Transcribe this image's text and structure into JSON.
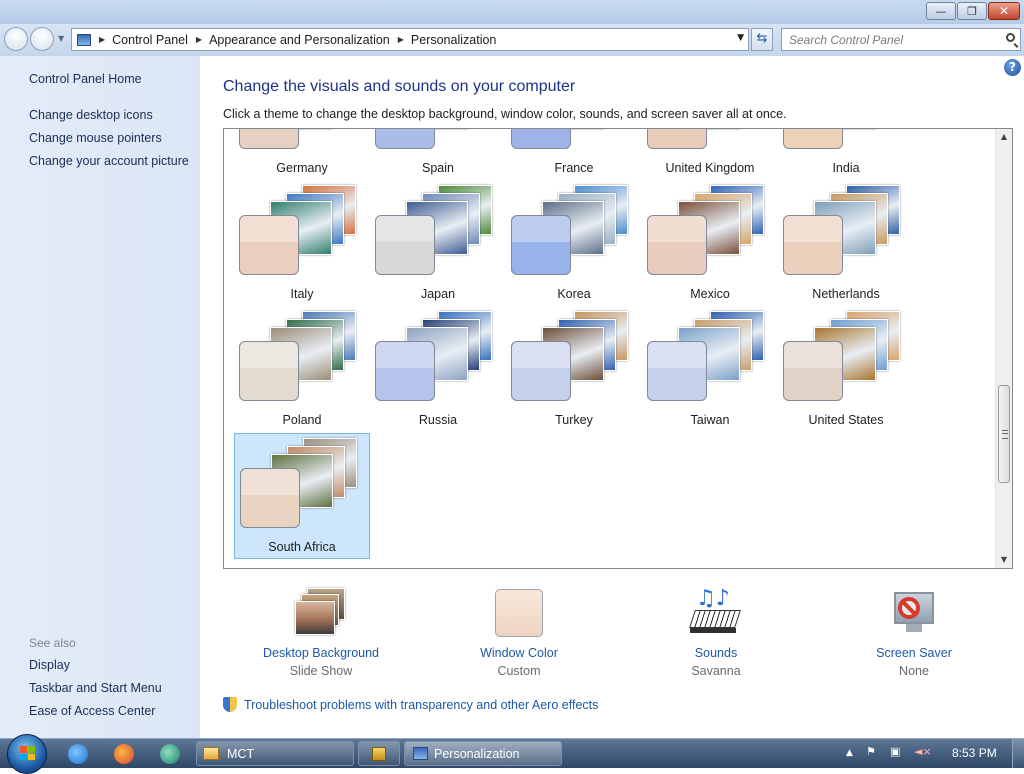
{
  "window": {
    "minimize_glyph": "—",
    "maximize_glyph": "❐",
    "close_glyph": "✕"
  },
  "address": {
    "breadcrumbs": [
      "Control Panel",
      "Appearance and Personalization",
      "Personalization"
    ],
    "search_placeholder": "Search Control Panel"
  },
  "sidebar": {
    "home": "Control Panel Home",
    "links": [
      "Change desktop icons",
      "Change mouse pointers",
      "Change your account picture"
    ],
    "see_also_label": "See also",
    "see_also": [
      "Display",
      "Taskbar and Start Menu",
      "Ease of Access Center"
    ]
  },
  "main": {
    "title": "Change the visuals and sounds on your computer",
    "subtitle": "Click a theme to change the desktop background, window color, sounds, and screen saver all at once.",
    "help": "?"
  },
  "themes": [
    {
      "name": "Germany",
      "tint": "#e6d0c2",
      "photos": [
        "#8a6a50",
        "#b9cfe3",
        "#6e7f63"
      ]
    },
    {
      "name": "Spain",
      "tint": "#a9bde8",
      "photos": [
        "#c9a772",
        "#7aa6d6",
        "#e0b07a"
      ]
    },
    {
      "name": "France",
      "tint": "#9fb3e9",
      "photos": [
        "#6a7fa8",
        "#d8c2a4",
        "#b05c44"
      ]
    },
    {
      "name": "United Kingdom",
      "tint": "#e8cbb8",
      "photos": [
        "#7f8f9f",
        "#c08a5a",
        "#5b7a98"
      ]
    },
    {
      "name": "India",
      "tint": "#eed2b8",
      "photos": [
        "#d0a060",
        "#b7c6d9",
        "#a67a4e"
      ]
    },
    {
      "name": "Italy",
      "tint": "#ebcfbe",
      "photos": [
        "#d5713c",
        "#3c78c0",
        "#2f7d6a"
      ]
    },
    {
      "name": "Japan",
      "tint": "#d8d8d8",
      "photos": [
        "#4d8b3a",
        "#6f8ab5",
        "#3e5c90"
      ]
    },
    {
      "name": "Korea",
      "tint": "#98b3ea",
      "photos": [
        "#4a8cd0",
        "#9ab0c4",
        "#5c6f88"
      ]
    },
    {
      "name": "Mexico",
      "tint": "#e9ccbb",
      "photos": [
        "#2e63b8",
        "#d5a66b",
        "#7a4f3a"
      ]
    },
    {
      "name": "Netherlands",
      "tint": "#ecd0be",
      "photos": [
        "#2f5ea8",
        "#c79a60",
        "#7e9eb8"
      ]
    },
    {
      "name": "Poland",
      "tint": "#e2dbcf",
      "photos": [
        "#4a79b8",
        "#2f6d49",
        "#9b8c76"
      ]
    },
    {
      "name": "Russia",
      "tint": "#b5c4ea",
      "photos": [
        "#3570c0",
        "#243f78",
        "#8ea2c2"
      ]
    },
    {
      "name": "Turkey",
      "tint": "#c6d0ea",
      "photos": [
        "#c7955f",
        "#2f62b0",
        "#6b4d3a"
      ]
    },
    {
      "name": "Taiwan",
      "tint": "#c5d0ec",
      "photos": [
        "#2d5fb0",
        "#c89f6a",
        "#7aa1c9"
      ]
    },
    {
      "name": "United States",
      "tint": "#e0d2c6",
      "photos": [
        "#d9a46a",
        "#6f9ed1",
        "#a7752f"
      ]
    },
    {
      "name": "South Africa",
      "tint": "#e8d2c0",
      "photos": [
        "#9a8f7d",
        "#c08b66",
        "#5e6f3f"
      ]
    }
  ],
  "settings": [
    {
      "name": "Desktop Background",
      "value": "Slide Show",
      "icon": "desktop-background-icon"
    },
    {
      "name": "Window Color",
      "value": "Custom",
      "icon": "window-color-icon",
      "color": "#f3dccb"
    },
    {
      "name": "Sounds",
      "value": "Savanna",
      "icon": "sounds-icon"
    },
    {
      "name": "Screen Saver",
      "value": "None",
      "icon": "screen-saver-icon"
    }
  ],
  "troubleshoot_link": "Troubleshoot problems with transparency and other Aero effects",
  "taskbar": {
    "buttons": [
      {
        "label": "MCT",
        "icon": "folder-icon"
      },
      {
        "label": "Personalization",
        "icon": "personalization-icon"
      }
    ],
    "clock": "8:53 PM"
  },
  "colors": {
    "link": "#1e58a8",
    "title": "#1e3287",
    "sidebar": "#dbe6f5",
    "selection": "#cde6fb"
  }
}
